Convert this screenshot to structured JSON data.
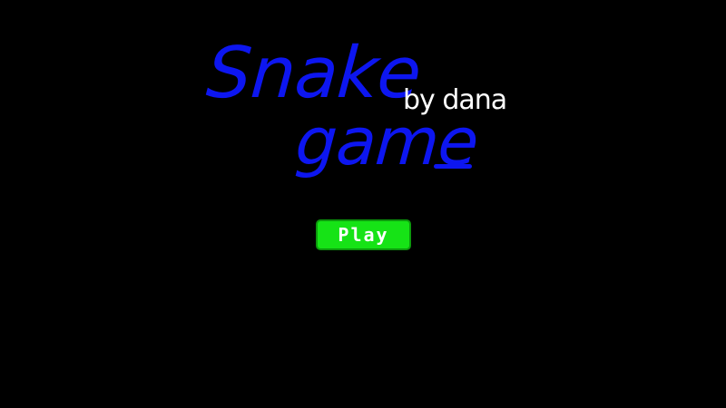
{
  "title": {
    "line1": "Snake",
    "line2": "game",
    "byline": "by dana"
  },
  "menu": {
    "play_label": "Play"
  },
  "colors": {
    "background": "#000000",
    "title": "#0d16f0",
    "byline": "#ffffff",
    "play_button_fill": "#16e316",
    "play_button_border": "#0c9a0c",
    "play_button_text": "#ffffff"
  }
}
